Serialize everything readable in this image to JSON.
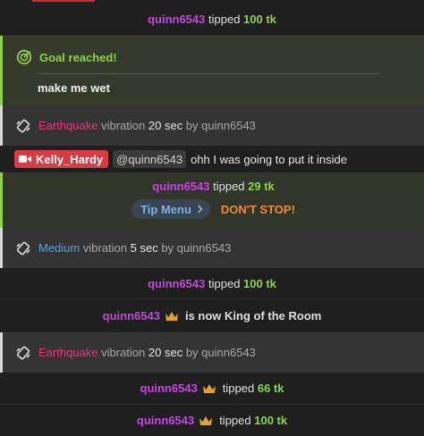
{
  "messages": {
    "tip1": {
      "user": "quinn6543",
      "action": "tipped",
      "amount": "100 tk"
    },
    "goal": {
      "title": "Goal reached!",
      "message": "make me wet"
    },
    "vib1": {
      "level": "Earthquake",
      "text": "vibration",
      "duration": "20 sec",
      "by": "by quinn6543"
    },
    "chat": {
      "user": "Kelly_Hardy",
      "mention": "@quinn6543",
      "text": "ohh I was going to put it inside"
    },
    "tip2": {
      "user": "quinn6543",
      "action": "tipped",
      "amount": "29 tk",
      "menu_label": "Tip Menu",
      "menu_item": "DON'T STOP!"
    },
    "vib2": {
      "level": "Medium",
      "text": "vibration",
      "duration": "5 sec",
      "by": "by quinn6543"
    },
    "tip3": {
      "user": "quinn6543",
      "action": "tipped",
      "amount": "100 tk"
    },
    "king": {
      "user": "quinn6543",
      "text": "is now King of the Room"
    },
    "vib3": {
      "level": "Earthquake",
      "text": "vibration",
      "duration": "20 sec",
      "by": "by quinn6543"
    },
    "tip4": {
      "user": "quinn6543",
      "action": "tipped",
      "amount": "66 tk"
    },
    "tip5": {
      "user": "quinn6543",
      "action": "tipped",
      "amount": "100 tk"
    }
  },
  "icons": {
    "goal": "target-icon",
    "vibration": "vibration-icon",
    "crown": "crown-icon",
    "broadcaster": "camera-icon",
    "chevron": "chevron-right-icon"
  },
  "colors": {
    "username": "#c447e0",
    "tip_amount": "#8fd14f",
    "earthquake": "#e0397e",
    "medium": "#5aa0de",
    "crown": "#e3a22a",
    "broadcaster_badge": "#d63c44",
    "tip_menu_item": "#ef8a3c"
  }
}
